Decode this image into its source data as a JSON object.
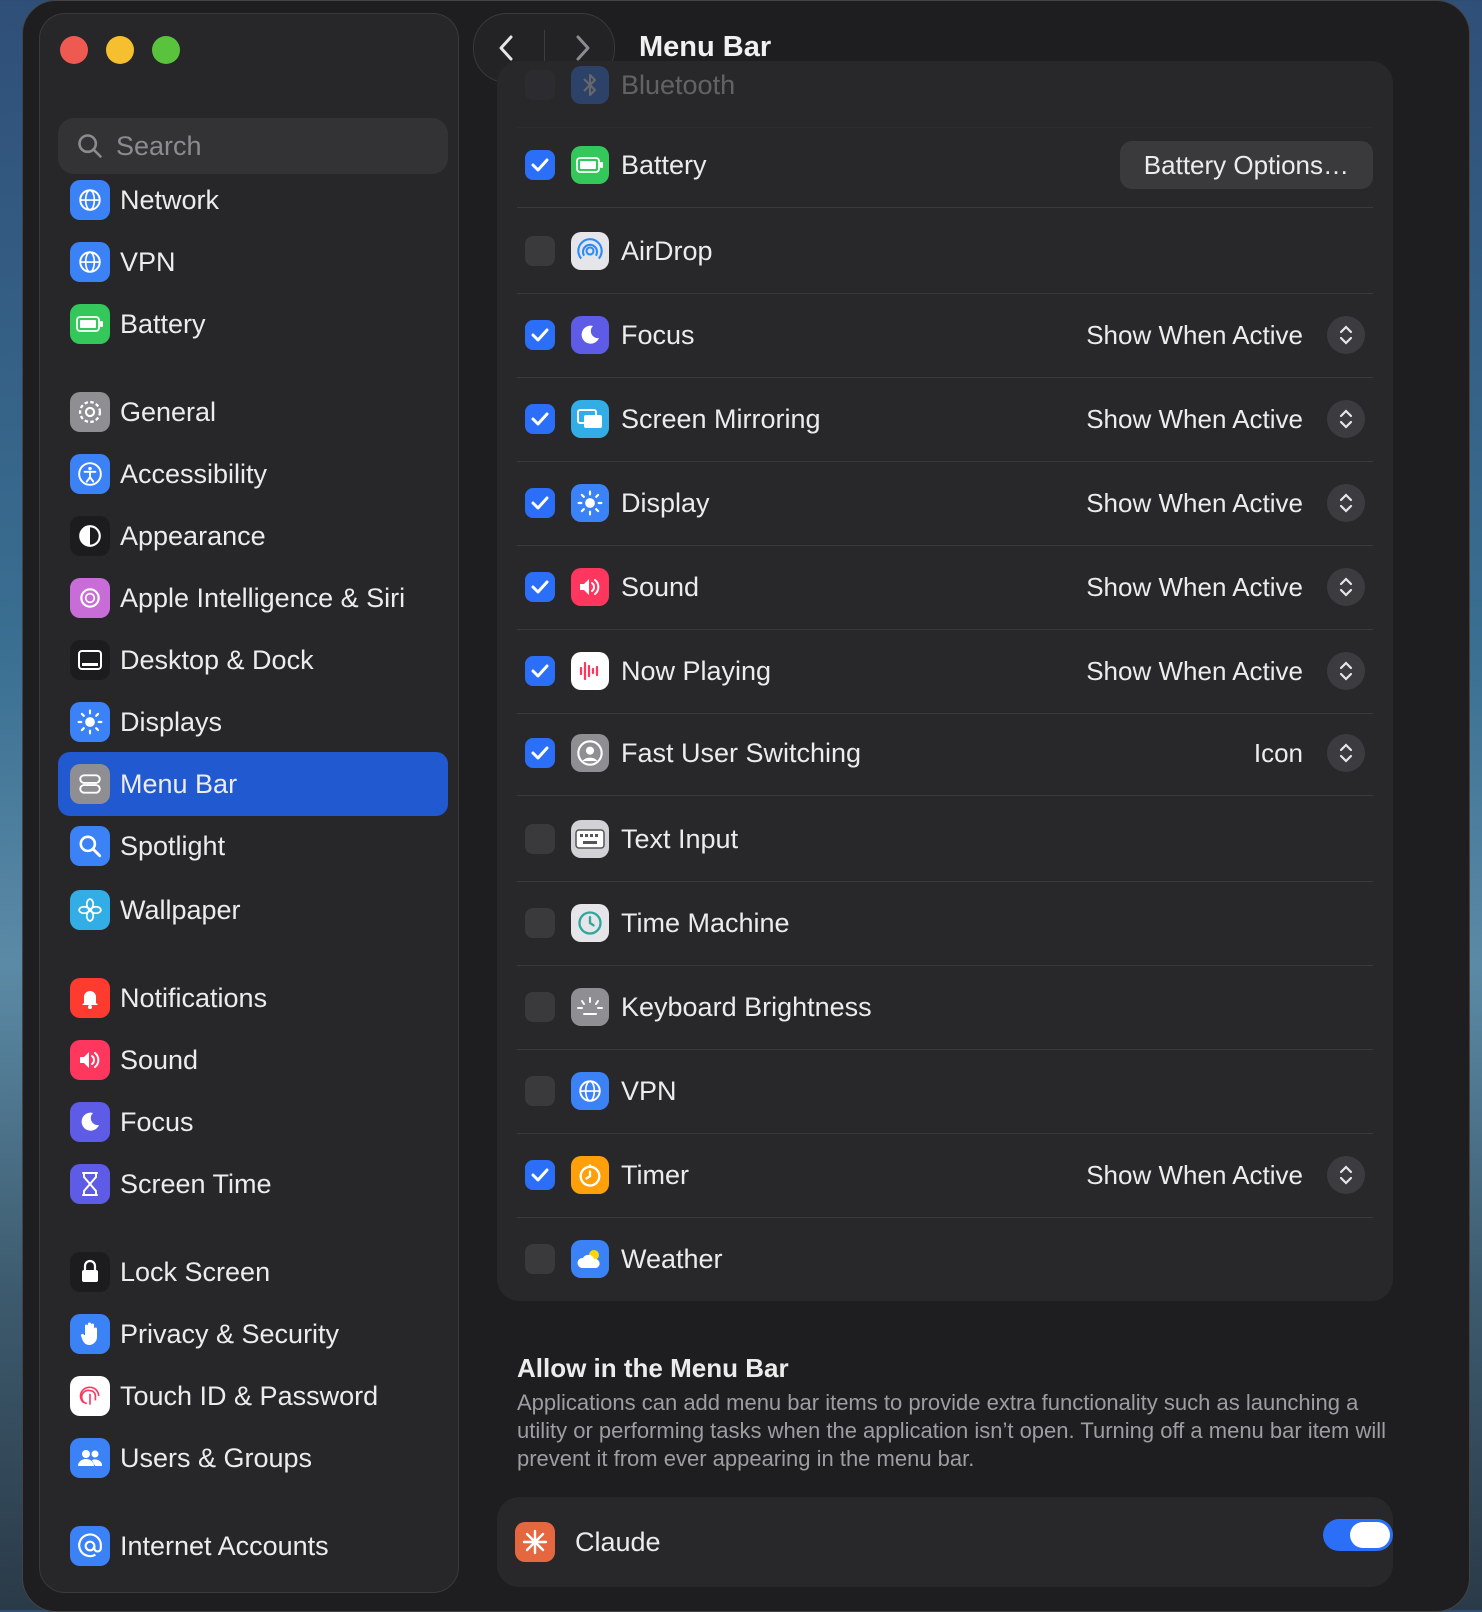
{
  "window": {
    "title": "Menu Bar"
  },
  "search": {
    "placeholder": "Search"
  },
  "sidebar": {
    "items": [
      {
        "label": "Network",
        "icon": "globe-icon",
        "color": "#3b82f6"
      },
      {
        "label": "VPN",
        "icon": "globe-icon",
        "color": "#3b82f6"
      },
      {
        "label": "Battery",
        "icon": "battery-icon",
        "color": "#34c759"
      },
      {
        "label": "General",
        "icon": "gear-icon",
        "color": "#8e8e93"
      },
      {
        "label": "Accessibility",
        "icon": "accessibility-icon",
        "color": "#3b82f6"
      },
      {
        "label": "Appearance",
        "icon": "appearance-icon",
        "color": "#1c1c1e"
      },
      {
        "label": "Apple Intelligence & Siri",
        "icon": "siri-icon",
        "color": "#c86dd7"
      },
      {
        "label": "Desktop & Dock",
        "icon": "dock-icon",
        "color": "#1c1c1e"
      },
      {
        "label": "Displays",
        "icon": "sun-icon",
        "color": "#3b82f6"
      },
      {
        "label": "Menu Bar",
        "icon": "menubar-icon",
        "color": "#8e8e93"
      },
      {
        "label": "Spotlight",
        "icon": "magnifier-icon",
        "color": "#3b82f6"
      },
      {
        "label": "Wallpaper",
        "icon": "flower-icon",
        "color": "#32ade6"
      },
      {
        "label": "Notifications",
        "icon": "bell-icon",
        "color": "#ff3b30"
      },
      {
        "label": "Sound",
        "icon": "speaker-icon",
        "color": "#ff375f"
      },
      {
        "label": "Focus",
        "icon": "moon-icon",
        "color": "#5e5ce6"
      },
      {
        "label": "Screen Time",
        "icon": "hourglass-icon",
        "color": "#5e5ce6"
      },
      {
        "label": "Lock Screen",
        "icon": "lock-icon",
        "color": "#1c1c1e"
      },
      {
        "label": "Privacy & Security",
        "icon": "hand-icon",
        "color": "#3b82f6"
      },
      {
        "label": "Touch ID & Password",
        "icon": "fingerprint-icon",
        "color": "#ffffff"
      },
      {
        "label": "Users & Groups",
        "icon": "users-icon",
        "color": "#3b82f6"
      },
      {
        "label": "Internet Accounts",
        "icon": "at-icon",
        "color": "#3b82f6"
      }
    ],
    "active": "Menu Bar"
  },
  "rows": [
    {
      "label": "Bluetooth",
      "checked": false,
      "icon": "bluetooth-icon",
      "color": "#3b82f6",
      "ghost": true
    },
    {
      "label": "Battery",
      "checked": true,
      "icon": "battery-icon",
      "color": "#34c759",
      "button": "Battery Options…"
    },
    {
      "label": "AirDrop",
      "checked": false,
      "icon": "airdrop-icon",
      "color": "#e5e5ea"
    },
    {
      "label": "Focus",
      "checked": true,
      "icon": "moon-icon",
      "color": "#5e5ce6",
      "select": "Show When Active"
    },
    {
      "label": "Screen Mirroring",
      "checked": true,
      "icon": "mirroring-icon",
      "color": "#32ade6",
      "select": "Show When Active"
    },
    {
      "label": "Display",
      "checked": true,
      "icon": "sun-icon",
      "color": "#3b82f6",
      "select": "Show When Active"
    },
    {
      "label": "Sound",
      "checked": true,
      "icon": "speaker-icon",
      "color": "#ff375f",
      "select": "Show When Active"
    },
    {
      "label": "Now Playing",
      "checked": true,
      "icon": "waveform-icon",
      "color": "#ffffff",
      "select": "Show When Active"
    },
    {
      "label": "Fast User Switching",
      "checked": true,
      "icon": "user-icon",
      "color": "#8e8e93",
      "select": "Icon"
    },
    {
      "label": "Text Input",
      "checked": false,
      "icon": "keyboard-icon",
      "color": "#d1d1d6"
    },
    {
      "label": "Time Machine",
      "checked": false,
      "icon": "clock-icon",
      "color": "#e5e5ea"
    },
    {
      "label": "Keyboard Brightness",
      "checked": false,
      "icon": "brightness-icon",
      "color": "#8e8e93"
    },
    {
      "label": "VPN",
      "checked": false,
      "icon": "globe-icon",
      "color": "#3b82f6"
    },
    {
      "label": "Timer",
      "checked": true,
      "icon": "timer-icon",
      "color": "#ff9f0a",
      "select": "Show When Active"
    },
    {
      "label": "Weather",
      "checked": false,
      "icon": "weather-icon",
      "color": "#3b82f6"
    }
  ],
  "allow": {
    "title": "Allow in the Menu Bar",
    "description": "Applications can add menu bar items to provide extra functionality such as launching a utility or performing tasks when the application isn’t open. Turning off a menu bar item will prevent it from ever appearing in the menu bar."
  },
  "apps": [
    {
      "label": "Claude",
      "enabled": true,
      "icon": "claude-icon",
      "color": "#e5673f"
    }
  ]
}
